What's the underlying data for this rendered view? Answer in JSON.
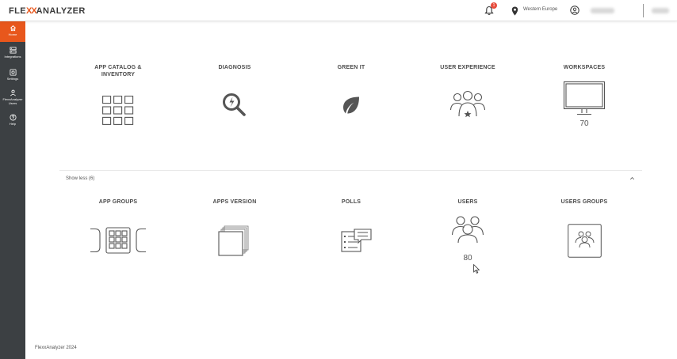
{
  "header": {
    "logo_part1": "FLE",
    "logo_part2": "XX",
    "logo_part3": "ANALYZER",
    "notifications_count": "1",
    "region": "Western Europe"
  },
  "sidebar": {
    "items": [
      {
        "label": "Home",
        "icon": "home-icon",
        "active": true
      },
      {
        "label": "Integrations",
        "icon": "integrations-icon",
        "active": false
      },
      {
        "label": "Settings",
        "icon": "settings-icon",
        "active": false
      },
      {
        "label": "FlexxAnalyzer Users",
        "icon": "user-icon",
        "active": false
      },
      {
        "label": "Help",
        "icon": "help-icon",
        "active": false
      }
    ]
  },
  "tiles_top": [
    {
      "title": "APP CATALOG & INVENTORY",
      "icon": "app-grid-icon"
    },
    {
      "title": "DIAGNOSIS",
      "icon": "diagnosis-icon"
    },
    {
      "title": "GREEN IT",
      "icon": "leaf-icon"
    },
    {
      "title": "USER EXPERIENCE",
      "icon": "user-experience-icon"
    },
    {
      "title": "WORKSPACES",
      "icon": "monitor-icon",
      "count": "70"
    }
  ],
  "show_less_label": "Show less (6)",
  "tiles_bottom": [
    {
      "title": "APP GROUPS",
      "icon": "app-groups-icon"
    },
    {
      "title": "APPS VERSION",
      "icon": "stacked-pages-icon"
    },
    {
      "title": "POLLS",
      "icon": "polls-icon"
    },
    {
      "title": "USERS",
      "icon": "users-icon",
      "count": "80"
    },
    {
      "title": "USERS GROUPS",
      "icon": "users-groups-icon"
    }
  ],
  "footer": "FlexxAnalyzer 2024",
  "colors": {
    "accent": "#e8571c",
    "sidebar": "#3c4043",
    "icon": "#555555"
  }
}
